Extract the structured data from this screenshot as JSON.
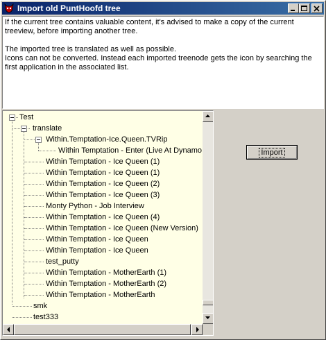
{
  "window": {
    "title": "Import old PuntHoofd tree",
    "controls": {
      "minimize": "minimize",
      "maximize": "maximize",
      "close": "close"
    }
  },
  "info_text": {
    "paragraph1": "If the current tree contains valuable content, it's advised to make a copy of the current treeview, before importing another tree.",
    "paragraph2": "The imported tree is translated as well as possible.\nIcons can not be converted. Instead each imported treenode gets the icon by searching the first application in the associated list."
  },
  "tree": {
    "root": "Test",
    "translate": "translate",
    "tvrip": "Within.Temptation-Ice.Queen.TVRip",
    "tvrip_child": "Within Temptation - Enter (Live At Dynamo)",
    "items": [
      "Within Temptation - Ice Queen (1)",
      "Within Temptation - Ice Queen (1)",
      "Within Temptation - Ice Queen (2)",
      "Within Temptation - Ice Queen (3)",
      "Monty Python - Job Interview",
      "Within Temptation - Ice Queen (4)",
      "Within Temptation - Ice Queen (New Version)",
      "Within Temptation - Ice Queen",
      "Within Temptation - Ice Queen",
      "test_putty",
      "Within Temptation - MotherEarth (1)",
      "Within Temptation - MotherEarth (2)",
      "Within Temptation - MotherEarth"
    ],
    "smk": "smk",
    "test333": "test333"
  },
  "buttons": {
    "import": "Import"
  }
}
